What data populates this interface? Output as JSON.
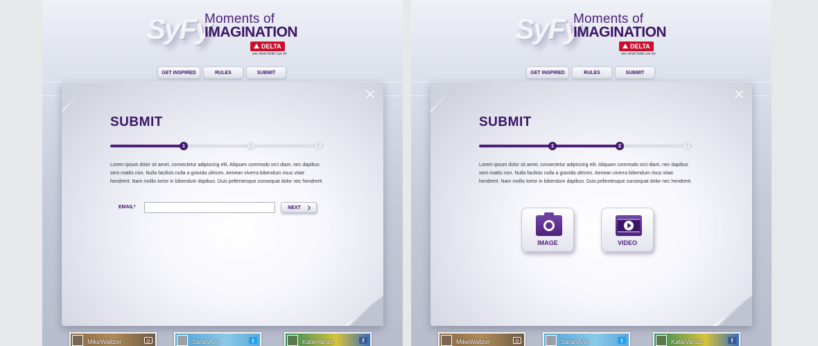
{
  "logo": {
    "brand": "SyFy",
    "line1": "Moments of",
    "line2": "IMAGINATION",
    "sponsor": "DELTA",
    "sponsor_tagline": "see what Delta can do"
  },
  "nav": {
    "items": [
      {
        "label": "GET INSPIRED"
      },
      {
        "label": "RULES"
      },
      {
        "label": "SUBMIT"
      }
    ]
  },
  "panels": [
    {
      "title": "SUBMIT",
      "progress": {
        "current_step": 1,
        "total_steps": 3,
        "steps": [
          "1",
          "2",
          "3"
        ]
      },
      "body_text": "Lorem ipsum dolor sit amet, consectetur adipiscing elit. Aliquam commodo orci diam, nec dapibus sem mattis non. Nulla facilisis nulla a gravida ultrices. Aenean viverra bibendum risus vitae hendrerit. Nam mollis tortor in bibendum dapibus. Duis pellentesque consequat dolor nec hendrerit.",
      "email_label": "EMAIL*",
      "email_value": "",
      "email_placeholder": "",
      "next_label": "NEXT"
    },
    {
      "title": "SUBMIT",
      "progress": {
        "current_step": 2,
        "total_steps": 3,
        "steps": [
          "1",
          "2",
          "3"
        ]
      },
      "body_text": "Lorem ipsum dolor sit amet, consectetur adipiscing elit. Aliquam commodo orci diam, nec dapibus sem mattis non. Nulla facilisis nulla a gravida ultrices. Aenean viverra bibendum risus vitae hendrerit. Nam mollis tortor in bibendum dapibus. Duis pellentesque consequat dolor nec hendrerit.",
      "image_label": "IMAGE",
      "video_label": "VIDEO"
    }
  ],
  "thumbnails": [
    {
      "name": "MikeWaltzer",
      "network": "instagram-icon"
    },
    {
      "name": "SarahAnn",
      "network": "twitter-icon"
    },
    {
      "name": "KatieVanzo",
      "network": "facebook-icon"
    }
  ],
  "colors": {
    "brand_purple": "#3b1367",
    "accent_purple": "#4c1f7a",
    "delta_red": "#c8102e"
  }
}
